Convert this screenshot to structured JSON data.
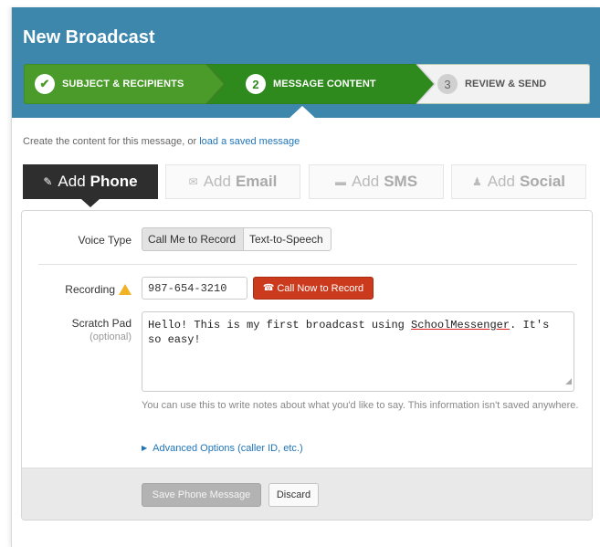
{
  "window": {
    "title": "New Broadcast"
  },
  "steps": [
    {
      "number": "✔",
      "label": "SUBJECT & RECIPIENTS",
      "state": "done"
    },
    {
      "number": "2",
      "label": "MESSAGE CONTENT",
      "state": "active"
    },
    {
      "number": "3",
      "label": "REVIEW & SEND",
      "state": "pending"
    }
  ],
  "colors": {
    "header": "#3d87ad",
    "step_done": "#4a9b2a",
    "step_active": "#2f8a1e",
    "call_button": "#cc3a1e"
  },
  "intro": {
    "text": "Create the content for this message, or ",
    "link": "load a saved message"
  },
  "tabs": [
    {
      "icon": "pencil-icon",
      "prefix": "Add",
      "name": "Phone",
      "selected": true
    },
    {
      "icon": "envelope-icon",
      "prefix": "Add",
      "name": "Email",
      "selected": false
    },
    {
      "icon": "chat-icon",
      "prefix": "Add",
      "name": "SMS",
      "selected": false
    },
    {
      "icon": "person-icon",
      "prefix": "Add",
      "name": "Social",
      "selected": false
    }
  ],
  "form": {
    "voice_type_label": "Voice Type",
    "voice_options": [
      "Call Me to Record",
      "Text-to-Speech"
    ],
    "voice_selected": "Call Me to Record",
    "recording_label": "Recording",
    "phone_value": "987-654-3210",
    "call_button": "Call Now to Record",
    "scratch_label": "Scratch Pad",
    "scratch_sublabel": "(optional)",
    "scratch_before": "Hello! This is my first broadcast using ",
    "scratch_misspelled": "SchoolMessenger",
    "scratch_after": ". It's so easy!",
    "help_text": "You can use this to write notes about what you'd like to say. This information isn't saved anywhere.",
    "advanced_link": "Advanced Options (caller ID, etc.)"
  },
  "footer": {
    "save_label": "Save Phone Message",
    "discard_label": "Discard"
  }
}
